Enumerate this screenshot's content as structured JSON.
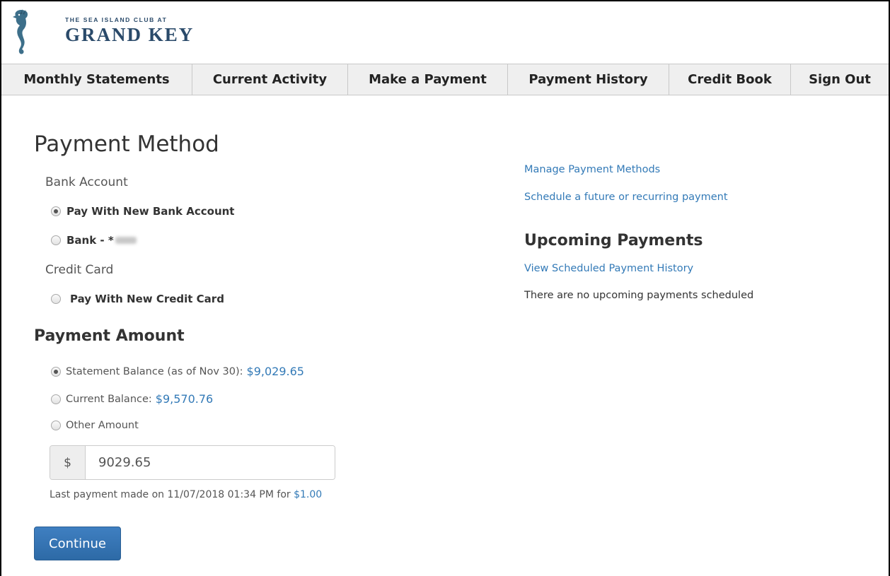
{
  "brand": {
    "line1": "THE SEA ISLAND CLUB AT",
    "line2": "GRAND KEY",
    "logo_icon": "seahorse-icon",
    "color": "#2a4a6a"
  },
  "nav": {
    "items": [
      {
        "label": "Monthly Statements"
      },
      {
        "label": "Current Activity"
      },
      {
        "label": "Make a Payment"
      },
      {
        "label": "Payment History"
      },
      {
        "label": "Credit Book"
      },
      {
        "label": "Sign Out"
      }
    ]
  },
  "payment_method": {
    "title": "Payment Method",
    "bank_heading": "Bank Account",
    "bank_options": [
      {
        "label": "Pay With New Bank Account",
        "checked": true
      },
      {
        "label": "Bank - *",
        "checked": false
      }
    ],
    "card_heading": "Credit Card",
    "card_options": [
      {
        "label": "Pay With New Credit Card",
        "checked": false
      }
    ]
  },
  "payment_amount": {
    "title": "Payment Amount",
    "options": [
      {
        "label": "Statement Balance (as of Nov 30):",
        "amount": "$9,029.65",
        "checked": true
      },
      {
        "label": "Current Balance:",
        "amount": "$9,570.76",
        "checked": false
      },
      {
        "label": "Other Amount",
        "amount": "",
        "checked": false
      }
    ],
    "currency_symbol": "$",
    "input_value": "9029.65",
    "last_payment_text": "Last payment made on 11/07/2018 01:34 PM for",
    "last_payment_amount": "$1.00",
    "continue_label": "Continue"
  },
  "sidebar": {
    "manage_link": "Manage Payment Methods",
    "schedule_link": "Schedule a future or recurring payment",
    "upcoming_title": "Upcoming Payments",
    "history_link": "View Scheduled Payment History",
    "no_upcoming_text": "There are no upcoming payments scheduled"
  },
  "colors": {
    "link": "#337ab7",
    "button": "#3270b0",
    "nav_bg": "#efefef"
  }
}
